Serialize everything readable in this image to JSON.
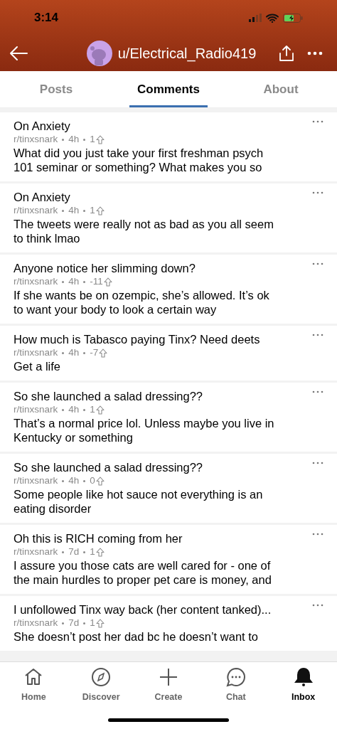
{
  "status_bar": {
    "time": "3:14"
  },
  "header": {
    "username": "u/Electrical_Radio419"
  },
  "tabs": [
    {
      "label": "Posts",
      "selected": false
    },
    {
      "label": "Comments",
      "selected": true
    },
    {
      "label": "About",
      "selected": false
    }
  ],
  "comments": [
    {
      "title": "On Anxiety",
      "subreddit": "r/tinxsnark",
      "age": "4h",
      "score": "1",
      "body": [
        "What did you just take your first freshman psych",
        "101 seminar or something? What makes you so"
      ]
    },
    {
      "title": "On Anxiety",
      "subreddit": "r/tinxsnark",
      "age": "4h",
      "score": "1",
      "body": [
        "The tweets were really not as bad as you all seem",
        "to think lmao"
      ]
    },
    {
      "title": "Anyone notice her slimming down?",
      "subreddit": "r/tinxsnark",
      "age": "4h",
      "score": "-11",
      "body": [
        "If she wants be on ozempic, she’s allowed. It’s ok",
        "to want your body to look a certain way"
      ]
    },
    {
      "title": "How much is Tabasco paying Tinx? Need deets",
      "subreddit": "r/tinxsnark",
      "age": "4h",
      "score": "-7",
      "body": [
        "Get a life"
      ]
    },
    {
      "title": "So she launched a salad dressing??",
      "subreddit": "r/tinxsnark",
      "age": "4h",
      "score": "1",
      "body": [
        "That’s a normal price lol. Unless maybe you live in",
        "Kentucky or something"
      ]
    },
    {
      "title": "So she launched a salad dressing??",
      "subreddit": "r/tinxsnark",
      "age": "4h",
      "score": "0",
      "body": [
        "Some people like hot sauce not everything is an",
        "eating disorder"
      ]
    },
    {
      "title": "Oh this is RICH coming from her",
      "subreddit": "r/tinxsnark",
      "age": "7d",
      "score": "1",
      "body": [
        "I assure you those cats are well cared for - one of",
        "the main hurdles to proper pet care is money, and"
      ]
    },
    {
      "title": "I unfollowed Tinx way back (her content tanked)...",
      "subreddit": "r/tinxsnark",
      "age": "7d",
      "score": "1",
      "body": [
        "She doesn’t post her dad bc he doesn’t want to"
      ]
    }
  ],
  "bottom_nav": [
    {
      "kind": "home",
      "label": "Home",
      "selected": false
    },
    {
      "kind": "discover",
      "label": "Discover",
      "selected": false
    },
    {
      "kind": "create",
      "label": "Create",
      "selected": false
    },
    {
      "kind": "chat",
      "label": "Chat",
      "selected": false
    },
    {
      "kind": "inbox",
      "label": "Inbox",
      "selected": true
    }
  ]
}
